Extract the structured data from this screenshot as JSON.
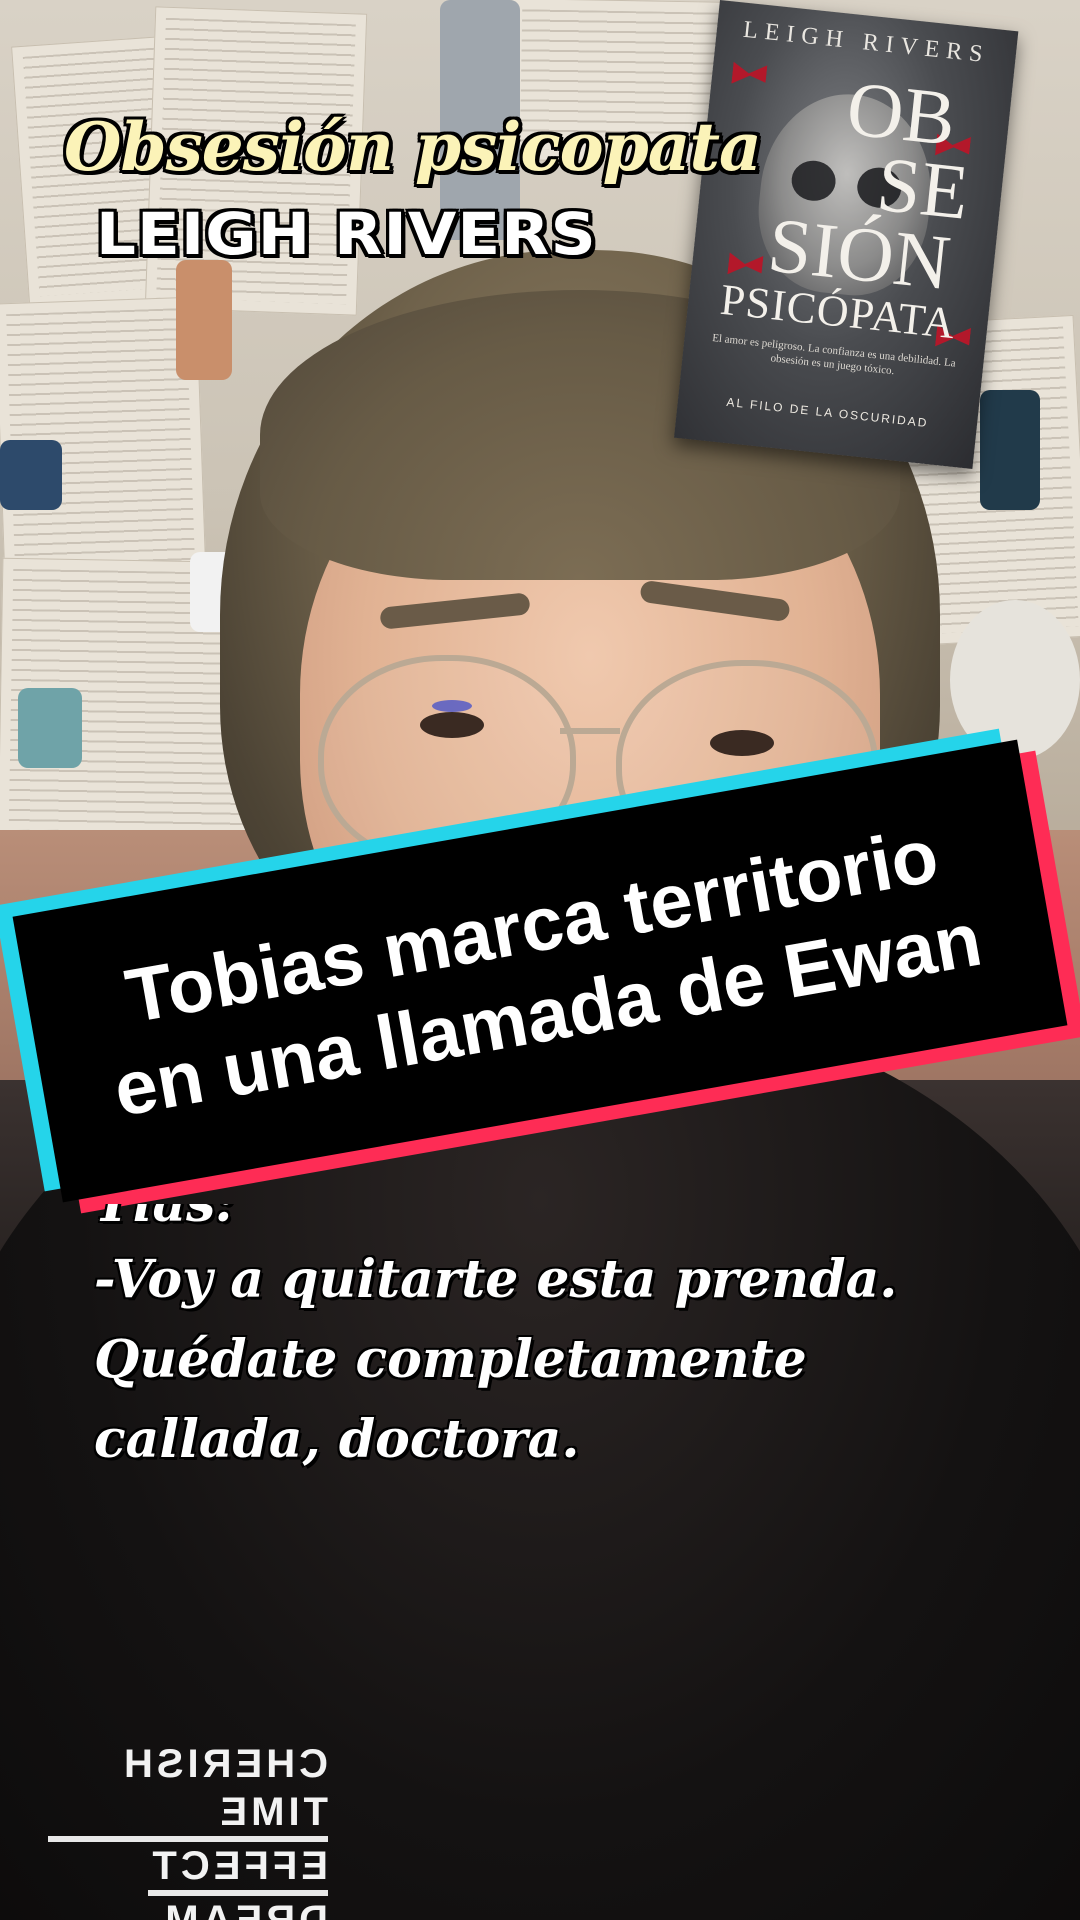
{
  "overlay": {
    "title": "Obsesión psicopata",
    "author": "LEIGH RIVERS"
  },
  "book_cover": {
    "author": "LEIGH RIVERS",
    "title_lines": [
      "OB",
      "SE",
      "SIÓN"
    ],
    "subtitle": "PSICÓPATA",
    "blurb": "El amor es peligroso. La confianza es una debilidad. La obsesión es un juego tóxico.",
    "series": "AL FILO DE LA OSCURIDAD"
  },
  "banner": {
    "line1": "Tobias marca territorio",
    "line2": "en una llamada de Ewan",
    "colors": {
      "cyan": "#25d4ea",
      "red": "#fe2c55",
      "black": "#000000"
    }
  },
  "caption": {
    "partial": "Tias:",
    "line1": "-Voy a quitarte esta prenda.",
    "line2": "Quédate completamente",
    "line3": "callada, doctora."
  },
  "shirt_print": [
    "CHERISH TIME",
    "EFFECT",
    "DREAM"
  ]
}
